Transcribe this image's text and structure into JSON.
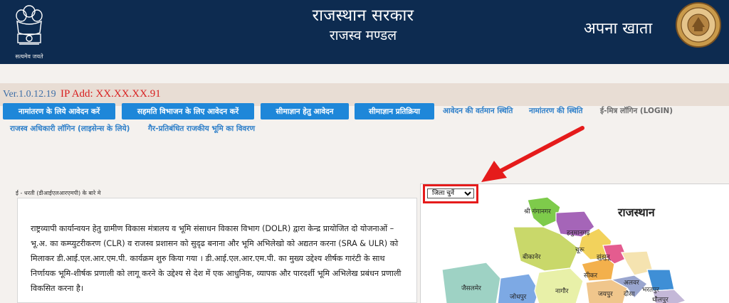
{
  "header": {
    "emblem_caption": "सत्यमेव जयते",
    "title": "राजस्थान सरकार",
    "subtitle": "राजस्व मण्डल",
    "app_name": "अपना खाता"
  },
  "status": {
    "version": "Ver.1.0.12.19",
    "ip": "IP Add: XX.XX.XX.91"
  },
  "nav": {
    "buttons": [
      {
        "label": "नामांतरण के लिये आवेदन करें"
      },
      {
        "label": "सहमति विभाजन के लिए आवेदन करें"
      },
      {
        "label": "सीमाज्ञान हेतु आवेदन"
      },
      {
        "label": "सीमाज्ञान प्रतिक्रिया"
      }
    ],
    "links": [
      {
        "label": "आवेदन की वर्तमान स्थिति"
      },
      {
        "label": "नामांतरण की स्थिति"
      },
      {
        "label": "ई-मित्र लॉगिन (LOGIN)"
      },
      {
        "label": "राजस्व अधिकारी लॉगिन (लाइसेन्स के लिये)"
      },
      {
        "label": "गैर-प्रतिबंधित राजकीय भूमि का विवरण"
      }
    ]
  },
  "about": {
    "label": "ई - धरती (डीआईएलआरएमपी) के बारे मे",
    "text": "राष्ट्रव्यापी कार्यान्वयन हेतु ग्रामीण विकास मंत्रालय व भूमि संसाधन विकास विभाग (DOLR) द्वारा केन्द्र प्रायोजित दो योजनाओं – भू.अ. का कम्प्युटरीकरण (CLR) व राजस्व प्रशासन को सुदृढ बनाना और भूमि अभिलेखो को अद्यतन करना (SRA & ULR) को मिलाकर डी.आई.एल.आर.एम.पी. कार्यक्रम शुरु किया गया । डी.आई.एल.आर.एम.पी. का मुख्य उद्देश्य शीर्षक गारंटी के साथ निर्णायक भूमि-शीर्षक प्रणाली को लागू करने के उद्देश्य से देश में एक आधुनिक, व्यापक और पारदर्शी भूमि अभिलेख प्रबंधन प्रणाली विकसित करना है।"
  },
  "map": {
    "district_select": "जिला चुनें",
    "title": "राजस्थान",
    "labels": [
      "श्री गंगानगर",
      "हनुमानगढ़",
      "चूरू",
      "बीकानेर",
      "झुंझुनू",
      "सीकर",
      "अलवर",
      "भरतपुर",
      "जैसलमेर",
      "जोधपुर",
      "नागौर",
      "जयपुर",
      "दौसा",
      "धौलपुर"
    ]
  },
  "colors": {
    "header_bg": "#0d2b50",
    "button_bg": "#1e87d9",
    "ip_red": "#d81e1e",
    "highlight_red": "#e51b1b"
  }
}
